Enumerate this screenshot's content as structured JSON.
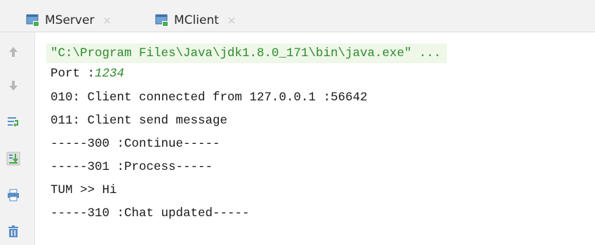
{
  "tabs": [
    {
      "label": "MServer",
      "close": "×",
      "icon": "run-config-icon"
    },
    {
      "label": "MClient",
      "close": "×",
      "icon": "run-config-icon"
    }
  ],
  "gutter": {
    "icons": [
      "arrow-up-icon",
      "arrow-down-icon",
      "soft-wrap-icon",
      "scroll-to-end-icon",
      "print-icon",
      "trash-icon"
    ]
  },
  "console": {
    "command": "\"C:\\Program Files\\Java\\jdk1.8.0_171\\bin\\java.exe\" ...",
    "port_label": "Port :",
    "port_value": "1234",
    "lines": [
      "010: Client connected from 127.0.0.1 :56642",
      "011: Client send message",
      "-----300 :Continue-----",
      "-----301 :Process-----",
      "TUM >> Hi",
      "-----310 :Chat updated-----"
    ]
  },
  "colors": {
    "command_text": "#2e8b2e",
    "command_bg": "#eef7e8",
    "port_value": "#2d8a2d",
    "text": "#1a1a1a"
  }
}
